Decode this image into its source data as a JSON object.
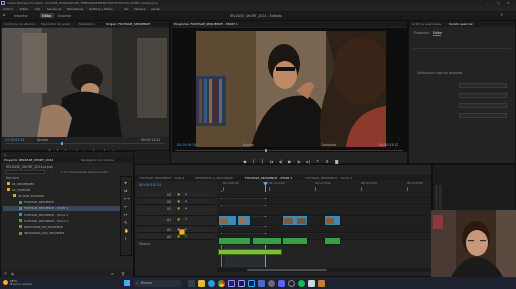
{
  "app": {
    "title": "Adobe Premiere Pro 2024 - D:\\CODE_RUSSO\\SHORT_TEMPLE\\PREMIERE PROYECTO\\FOR_SHORT_2024\\prproj",
    "colors": {
      "accent_blue": "#2d8ceb",
      "playhead": "#4ea6ff",
      "video_clip": "#3d8bb0",
      "audio_clip": "#3a9e48",
      "selected_clip": "#e6b422",
      "panel_bg": "#232323"
    }
  },
  "menu": [
    "Archivo",
    "Editar",
    "Clip",
    "Secuencia",
    "Marcadores",
    "Gráficos y títulos",
    "Ver",
    "Ventana",
    "Ayuda"
  ],
  "workspace": {
    "left_tabs": [
      "Importar",
      "Editar",
      "Exportar"
    ],
    "active": "Editar",
    "center_title": "RELEASE_SHORT_2024 - Editado"
  },
  "source": {
    "tabs": [
      "Controles de efectos",
      "Mezclador de audio",
      "Metadatos",
      "Origen: FOOTAGE_SEQUENCE"
    ],
    "timecode": "17:12:03:14",
    "fit": "Ajustar",
    "duration": "00:00:14:21"
  },
  "program": {
    "tab": "Programa: FOOTAGE_SEQUENCE - START 1",
    "timecode": "00:19:10:14",
    "fit": "Ajustar",
    "quality": "Completo",
    "duration": "00:00:53:12"
  },
  "right_panel": {
    "tabs": [
      "Gráficos esenciales",
      "Sonido esencial"
    ],
    "sub_tabs": [
      "Examinar",
      "Editar"
    ],
    "message": "Seleccione clips sin etiqueta"
  },
  "project": {
    "tabs": [
      "Proyecto: RELEASE_SHORT_2024",
      "Navegador de medios"
    ],
    "name": "RELEASE_SHORT_2024.prproj",
    "selection": "1 de 15 elementos seleccionados",
    "header": "Nombre",
    "items": [
      "01_SEQUENCES",
      "02_FOOTAGE",
      "03_RAW_FOOTAGE",
      "FOOTAGE_SEQUENCE",
      "FOOTAGE_SEQUENCE - START 1",
      "FOOTAGE_SEQUENCE - Tramo 1",
      "FOOTAGE_SEQUENCE - Tramo 2",
      "RESTAURAR_DE_SEQUENCE",
      "INSTAGRAM_ADS_SEQUENCE"
    ]
  },
  "timeline": {
    "tabs": [
      "FOOTAGE_SEQUENCE - Vista 1",
      "SEQUENCE_2_SEQUENCE",
      "FOOTAGE_SEQUENCE - START 1",
      "FOOTAGE_SEQUENCE - Tramo 1"
    ],
    "active_tab_index": 2,
    "timecode": "00:19:10:14",
    "ruler": [
      "00:19:05:00",
      "00:19:10:00",
      "00:19:15:00",
      "00:19:20:00",
      "00:19:25:00"
    ],
    "video_tracks": [
      "V3",
      "V2",
      "V1"
    ],
    "audio_tracks": [
      "A1",
      "A2",
      "A3"
    ],
    "master": "Mezcla"
  },
  "taskbar": {
    "weather_temp": "16°C",
    "weather_desc": "Mayorm. soleado",
    "search_placeholder": "Buscar"
  }
}
